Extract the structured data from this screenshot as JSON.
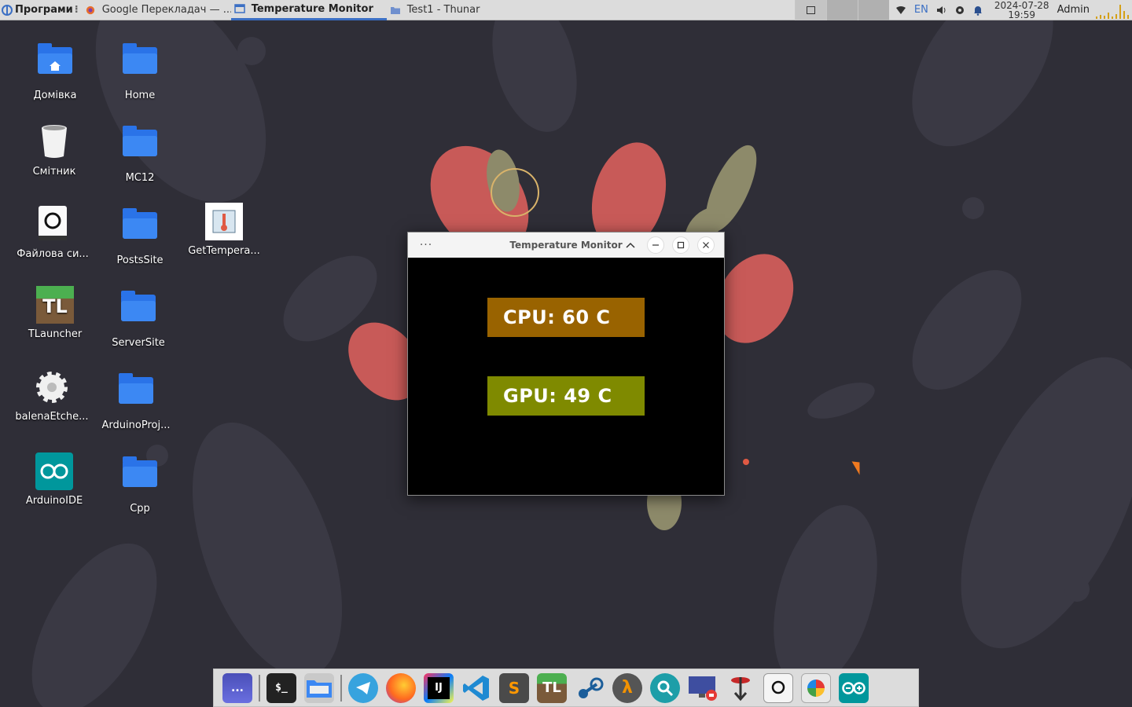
{
  "top_panel": {
    "menu_label": "Програми",
    "tasks": [
      {
        "label": "Google Перекладач — ...",
        "icon": "firefox-icon",
        "active": false
      },
      {
        "label": "Temperature Monitor",
        "icon": "window-icon",
        "active": true
      },
      {
        "label": "Test1 - Thunar",
        "icon": "folder-icon",
        "active": false
      }
    ],
    "tray": {
      "language": "EN",
      "date": "2024-07-28",
      "time": "19:59",
      "user": "Admin"
    }
  },
  "desktop_icons": [
    {
      "label": "Домівка",
      "icon": "home-folder-icon"
    },
    {
      "label": "Home",
      "icon": "folder-icon"
    },
    {
      "label": "Смітник",
      "icon": "trash-icon"
    },
    {
      "label": "MC12",
      "icon": "folder-icon"
    },
    {
      "label": "Файлова си...",
      "icon": "drive-icon"
    },
    {
      "label": "PostsSite",
      "icon": "folder-icon"
    },
    {
      "label": "GetTempera...",
      "icon": "thermometer-chip-icon"
    },
    {
      "label": "TLauncher",
      "icon": "tlauncher-icon"
    },
    {
      "label": "ServerSite",
      "icon": "folder-icon"
    },
    {
      "label": "balenaEtche...",
      "icon": "gear-icon"
    },
    {
      "label": "ArduinoProj...",
      "icon": "folder-icon"
    },
    {
      "label": "ArduinoIDE",
      "icon": "arduino-icon"
    },
    {
      "label": "Cpp",
      "icon": "folder-icon"
    }
  ],
  "window": {
    "title": "Temperature Monitor",
    "menu_glyph": "···",
    "cpu_text": "CPU: 60 C",
    "gpu_text": "GPU: 49 C",
    "cpu_color": "#996300",
    "gpu_color": "#7f8a00"
  },
  "dock": {
    "items": [
      {
        "icon": "show-desktop-icon",
        "label": "..."
      },
      {
        "icon": "terminal-icon",
        "label": "$_"
      },
      {
        "icon": "file-manager-icon",
        "label": ""
      },
      {
        "icon": "telegram-icon",
        "label": ""
      },
      {
        "icon": "firefox-icon",
        "label": ""
      },
      {
        "icon": "intellij-icon",
        "label": "IJ"
      },
      {
        "icon": "vscode-icon",
        "label": ""
      },
      {
        "icon": "sublime-icon",
        "label": "S"
      },
      {
        "icon": "tlauncher-icon",
        "label": "TL"
      },
      {
        "icon": "steam-icon",
        "label": ""
      },
      {
        "icon": "half-life-icon",
        "label": "λ"
      },
      {
        "icon": "search-icon",
        "label": ""
      },
      {
        "icon": "screen-recorder-icon",
        "label": ""
      },
      {
        "icon": "download-icon",
        "label": ""
      },
      {
        "icon": "drive-icon",
        "label": ""
      },
      {
        "icon": "image-viewer-icon",
        "label": ""
      },
      {
        "icon": "arduino-icon",
        "label": ""
      }
    ]
  }
}
